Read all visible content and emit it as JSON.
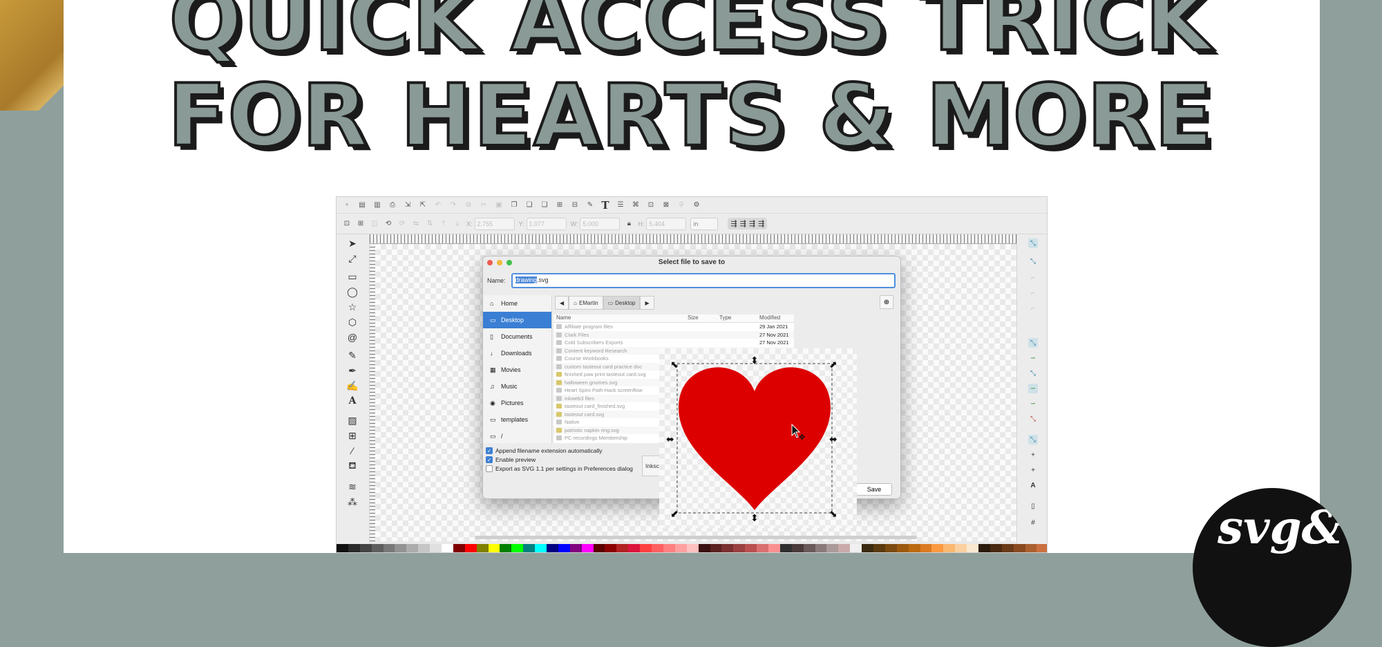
{
  "headline": {
    "line1": "QUICK ACCESS TRICK",
    "line2": "FOR HEARTS & MORE"
  },
  "logo_text": "svg&",
  "inkscape": {
    "fields": [
      {
        "label": "X:",
        "value": "2.755"
      },
      {
        "label": "Y:",
        "value": "1.077"
      },
      {
        "label": "W:",
        "value": "5.000"
      },
      {
        "label": "H:",
        "value": "5.404"
      }
    ],
    "unit": "in",
    "palette": [
      "#111111",
      "#2a2a2a",
      "#444444",
      "#5e5e5e",
      "#787878",
      "#929292",
      "#acacac",
      "#c6c6c6",
      "#e0e0e0",
      "#ffffff",
      "#800000",
      "#ff0000",
      "#808000",
      "#ffff00",
      "#008000",
      "#00ff00",
      "#008080",
      "#00ffff",
      "#000080",
      "#0000ff",
      "#800080",
      "#ff00ff",
      "#5a0000",
      "#8b0000",
      "#b22222",
      "#dc143c",
      "#ff4040",
      "#ff6060",
      "#ff8080",
      "#ffa0a0",
      "#ffc0c0",
      "#3a1010",
      "#5a2020",
      "#7a3030",
      "#9a4040",
      "#ba5050",
      "#da7070",
      "#fa9090",
      "#2f2f2f",
      "#4a3a3a",
      "#6a5a5a",
      "#8a7a7a",
      "#aa9a9a",
      "#caaaaa",
      "#f0f0f0",
      "#3b2a10",
      "#5b3a10",
      "#7b4a10",
      "#9b5a10",
      "#bb6a10",
      "#db7a20",
      "#fb9a40",
      "#fbb870",
      "#fbd0a0",
      "#fbe8d0",
      "#2a1a0a",
      "#4a2a10",
      "#6a3a18",
      "#8a4a20",
      "#aa6030",
      "#ca7040"
    ]
  },
  "dialog": {
    "title": "Select file to save to",
    "name_label": "Name:",
    "name_selected": "drawing",
    "name_ext": ".svg",
    "places": [
      "Home",
      "Desktop",
      "Documents",
      "Downloads",
      "Movies",
      "Music",
      "Pictures",
      "templates",
      "/"
    ],
    "crumbs": [
      "EMartin",
      "Desktop"
    ],
    "columns": [
      "Name",
      "Size",
      "Type",
      "Modified"
    ],
    "files": [
      {
        "name": "Affiliate program files",
        "modified": "29 Jan 2021"
      },
      {
        "name": "Clark Files",
        "modified": "27 Nov 2021"
      },
      {
        "name": "Cold Subscribers Exports",
        "modified": "27 Nov 2021"
      },
      {
        "name": "Content keyword Research",
        "modified": ""
      },
      {
        "name": "Course Workbooks",
        "modified": ""
      },
      {
        "name": "custom tasteout card practice doc",
        "modified": ""
      },
      {
        "name": "finished paw print tasteout card.svg",
        "modified": ""
      },
      {
        "name": "halloween gnomes.svg",
        "modified": ""
      },
      {
        "name": "Heart Spiro Path Hack screenflow",
        "modified": ""
      },
      {
        "name": "inkweb3 files",
        "modified": ""
      },
      {
        "name": "tasteout card_finished.svg",
        "modified": ""
      },
      {
        "name": "tasteout card.svg",
        "modified": ""
      },
      {
        "name": "Native",
        "modified": ""
      },
      {
        "name": "patriotic napkin ring.svg",
        "modified": ""
      },
      {
        "name": "PC recordings Membership",
        "modified": ""
      }
    ],
    "options": [
      {
        "label": "Append filename extension automatically",
        "checked": true
      },
      {
        "label": "Enable preview",
        "checked": true
      },
      {
        "label": "Export as SVG 1.1 per settings in Preferences dialog",
        "checked": false
      }
    ],
    "inkscape_btn": "Inksc",
    "save_label": "Save"
  },
  "heart_color": "#dd0000"
}
